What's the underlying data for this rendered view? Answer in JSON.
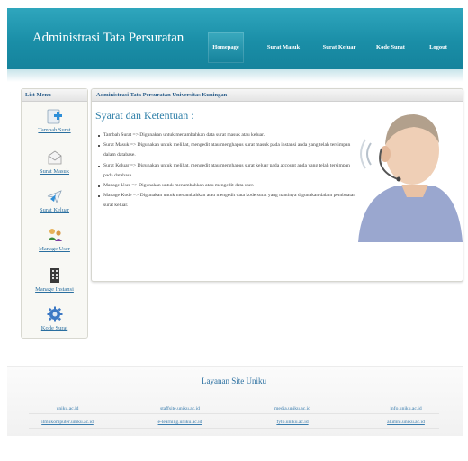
{
  "header": {
    "title": "Administrasi Tata Persuratan",
    "nav": [
      {
        "label": "Homepage",
        "active": true
      },
      {
        "label": "Surat Masuk",
        "active": false
      },
      {
        "label": "Surat Keluar",
        "active": false
      },
      {
        "label": "Kode Surat",
        "active": false
      },
      {
        "label": "Logout",
        "active": false
      }
    ]
  },
  "sidebar": {
    "heading": "List Menu",
    "items": [
      {
        "label": "Tambah Surat",
        "icon": "add-document-icon"
      },
      {
        "label": "Surat Masuk",
        "icon": "envelope-icon"
      },
      {
        "label": "Surat Keluar",
        "icon": "send-mail-icon"
      },
      {
        "label": "Manage User",
        "icon": "users-icon"
      },
      {
        "label": "Manage Instansi",
        "icon": "building-icon"
      },
      {
        "label": "Kode Surat",
        "icon": "gear-icon"
      }
    ]
  },
  "main": {
    "heading": "Administrasi Tata Persuratan Universitas Kuningan",
    "title": "Syarat dan Ketentuan :",
    "rules": [
      "Tambah Surat => Digunakan untuk menambahkan data surat masuk atau keluar.",
      "Surat Masuk => Digunakan untuk melihat, mengedit atau menghapus surat masuk pada instansi anda yang telah tersimpan dalam database.",
      "Surat Keluar => Digunakan untuk melihat, mengedit atau menghapus surat keluar pada account anda yang telah tersimpan pada database.",
      "Manage User => Digunakan untuk menambahkan atau mengedit data user.",
      "Manage Kode => Digunakan untuk menambahkan atau mengedit data kode surat yang nantinya digunakan dalam pembuatan surat keluar."
    ]
  },
  "footer": {
    "title": "Layanan Site Uniku",
    "links": [
      [
        "uniku.ac.id",
        "staffsite.uniku.ac.id",
        "media.uniku.ac.id",
        "info.uniku.ac.id"
      ],
      [
        "ilmukomputer.uniku.ac.id",
        "e-learning.uniku.ac.id",
        "fyto.uniku.ac.id",
        "alumni.uniku.ac.id"
      ]
    ]
  },
  "colors": {
    "header": "#1a8ea7",
    "link": "#2a6fa0",
    "heading": "#2a5d8a"
  }
}
